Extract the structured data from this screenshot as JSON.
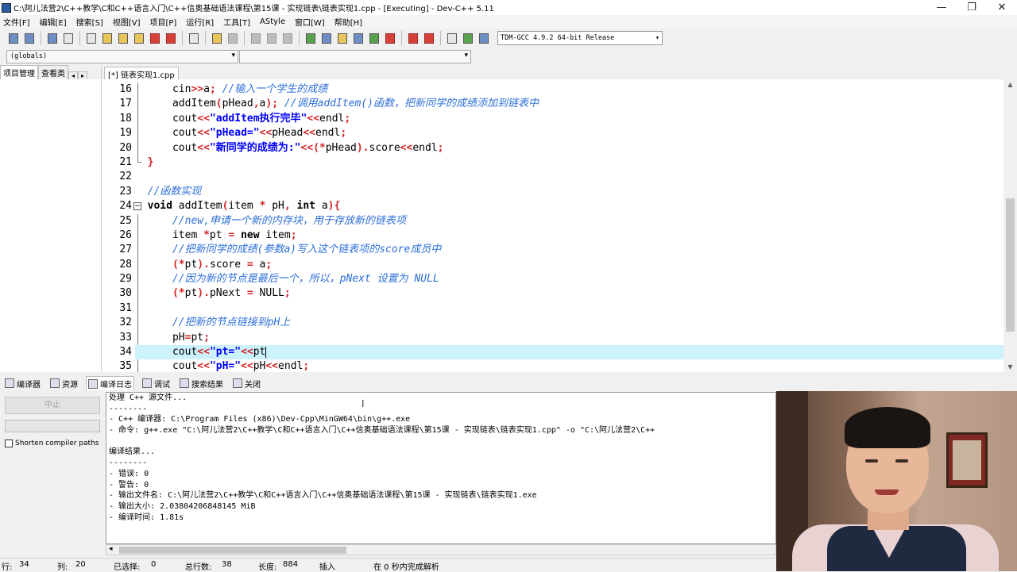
{
  "window": {
    "title": "C:\\阿儿法营2\\C++教学\\C和C++语言入门\\C++信奥基础语法课程\\第15课 - 实现链表\\链表实现1.cpp - [Executing] - Dev-C++ 5.11",
    "min": "—",
    "max": "❐",
    "close": "✕"
  },
  "menu": [
    "文件[F]",
    "编辑[E]",
    "搜索[S]",
    "视图[V]",
    "项目[P]",
    "运行[R]",
    "工具[T]",
    "AStyle",
    "窗口[W]",
    "帮助[H]"
  ],
  "toolbar": {
    "compiler_select": "TDM-GCC 4.9.2 64-bit Release"
  },
  "selectbar": {
    "scope": "(globals)",
    "symbol": ""
  },
  "left_panel": {
    "tabs": [
      "项目管理",
      "查看类"
    ]
  },
  "editor_tab": "[*] 链表实现1.cpp",
  "editor": {
    "line_numbers": [
      "16",
      "17",
      "18",
      "19",
      "20",
      "21",
      "22",
      "23",
      "24",
      "25",
      "26",
      "27",
      "28",
      "29",
      "30",
      "31",
      "32",
      "33",
      "34",
      "35"
    ],
    "current_line": "34"
  },
  "bottom_tabs": [
    "编译器",
    "资源",
    "编译日志",
    "调试",
    "搜索结果",
    "关闭"
  ],
  "compile_panel": {
    "abort": "中止",
    "shorten": "Shorten compiler paths"
  },
  "log_lines": [
    "处理 C++ 源文件...",
    "--------",
    "- C++ 编译器: C:\\Program Files (x86)\\Dev-Cpp\\MinGW64\\bin\\g++.exe",
    "- 命令: g++.exe \"C:\\阿儿法营2\\C++教学\\C和C++语言入门\\C++信奥基础语法课程\\第15课 - 实现链表\\链表实现1.cpp\" -o \"C:\\阿儿法营2\\C++",
    "",
    "编译结果...",
    "--------",
    "- 错误: 0",
    "- 警告: 0",
    "- 输出文件名: C:\\阿儿法营2\\C++教学\\C和C++语言入门\\C++信奥基础语法课程\\第15课 - 实现链表\\链表实现1.exe",
    "- 输出大小: 2.03804206848145 MiB",
    "- 编译时间: 1.81s"
  ],
  "status": {
    "row_label": "行:",
    "row": "34",
    "col_label": "列:",
    "col": "20",
    "sel_label": "已选择:",
    "sel": "0",
    "total_label": "总行数:",
    "total": "38",
    "len_label": "长度:",
    "len": "884",
    "mode": "插入",
    "parse": "在 0 秒内完成解析"
  }
}
